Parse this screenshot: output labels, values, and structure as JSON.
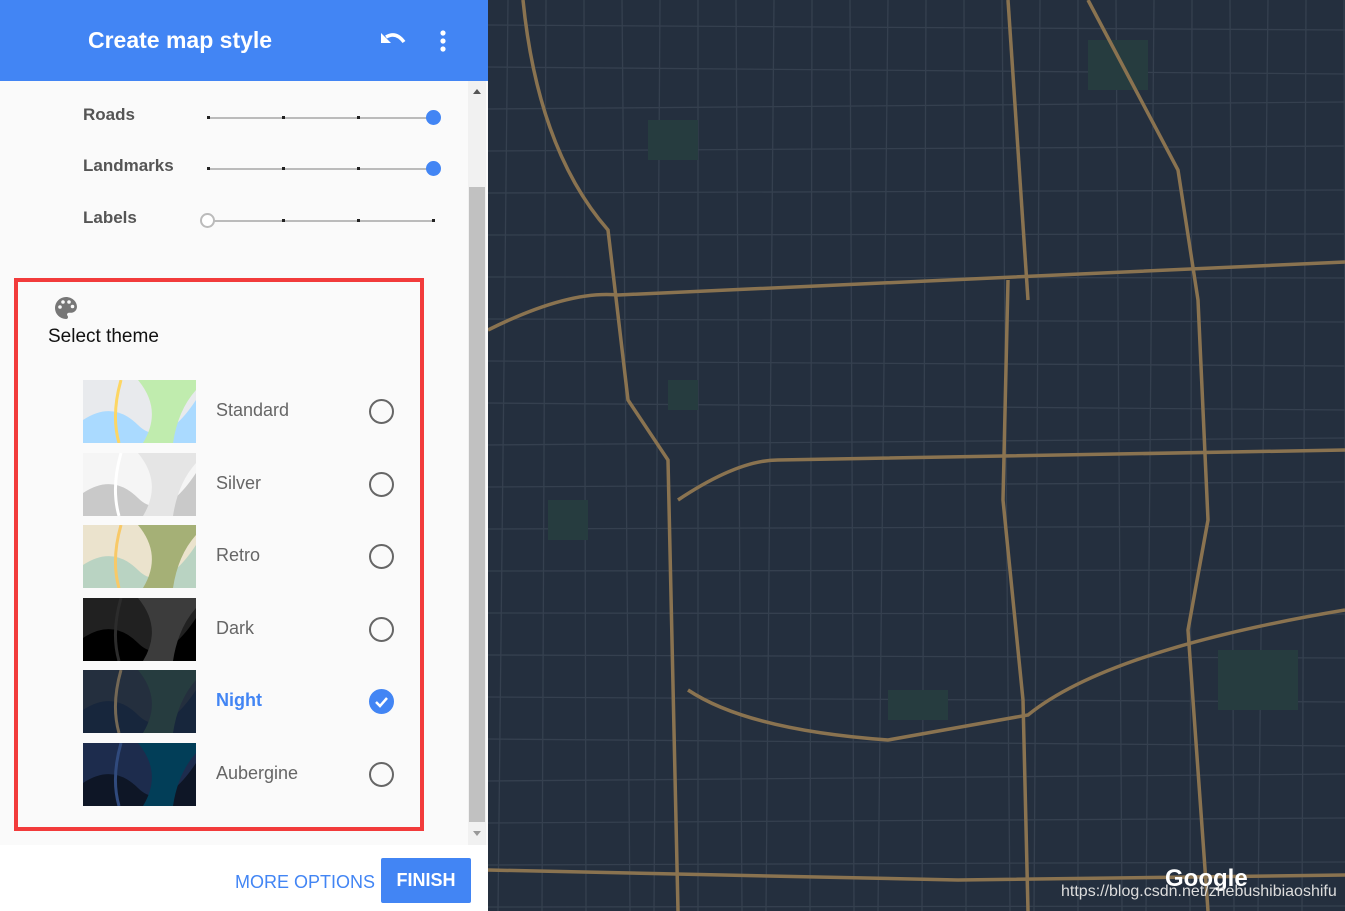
{
  "header": {
    "title": "Create map style",
    "undo_icon": "undo-icon",
    "more_icon": "more-vert-icon"
  },
  "density": [
    {
      "label": "Roads",
      "value": 3,
      "max": 3
    },
    {
      "label": "Landmarks",
      "value": 3,
      "max": 3
    },
    {
      "label": "Labels",
      "value": 0,
      "max": 3
    }
  ],
  "theme": {
    "icon": "palette-icon",
    "title": "Select theme",
    "selected": "Night",
    "options": [
      {
        "label": "Standard",
        "colors": [
          "#e8eaed",
          "#aadaff",
          "#c0ecae",
          "#fdd663"
        ]
      },
      {
        "label": "Silver",
        "colors": [
          "#f5f5f5",
          "#c9c9c9",
          "#e5e5e5",
          "#ffffff"
        ]
      },
      {
        "label": "Retro",
        "colors": [
          "#ebe3cd",
          "#b9d3c2",
          "#a5b076",
          "#f8c967"
        ]
      },
      {
        "label": "Dark",
        "colors": [
          "#212121",
          "#000000",
          "#3c3c3c",
          "#2c2c2c"
        ]
      },
      {
        "label": "Night",
        "colors": [
          "#242f3e",
          "#17263c",
          "#263c3f",
          "#746855"
        ]
      },
      {
        "label": "Aubergine",
        "colors": [
          "#1d2c4d",
          "#0e1626",
          "#023e58",
          "#304a7d"
        ]
      }
    ]
  },
  "footer": {
    "more_options": "MORE OPTIONS",
    "finish": "FINISH"
  },
  "map": {
    "logo": "Google",
    "watermark": "https://blog.csdn.net/zhebushibiaoshifu",
    "background": "#242f3e",
    "road_color": "#8a7350"
  },
  "colors": {
    "accent": "#4285f4",
    "highlight_border": "#f23b3b"
  }
}
